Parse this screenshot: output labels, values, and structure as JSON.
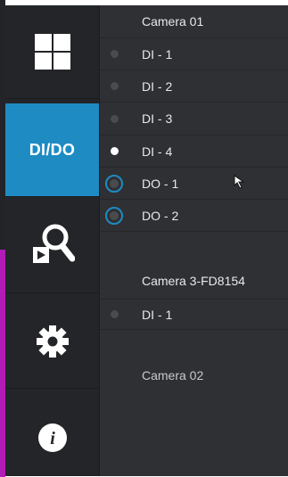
{
  "sidebar": {
    "items": [
      {
        "name": "layout",
        "icon": "grid-layout-icon"
      },
      {
        "name": "dido",
        "label": "DI/DO",
        "active": true
      },
      {
        "name": "search",
        "icon": "search-playback-icon"
      },
      {
        "name": "settings",
        "icon": "gear-icon"
      },
      {
        "name": "info",
        "icon": "info-icon"
      }
    ]
  },
  "panel": {
    "camera1": {
      "title": "Camera 01",
      "inputs": [
        {
          "label": "DI - 1",
          "state": "off"
        },
        {
          "label": "DI - 2",
          "state": "off"
        },
        {
          "label": "DI - 3",
          "state": "off"
        },
        {
          "label": "DI - 4",
          "state": "on"
        }
      ],
      "outputs": [
        {
          "label": "DO - 1"
        },
        {
          "label": "DO - 2"
        }
      ]
    },
    "camera2": {
      "title": "Camera 3-FD8154",
      "inputs": [
        {
          "label": "DI - 1",
          "state": "off"
        }
      ]
    },
    "camera3": {
      "title": "Camera 02"
    }
  },
  "colors": {
    "accent": "#1e8bc3",
    "sidebar_bg": "#232528",
    "panel_bg": "#2f3034",
    "magenta_strip": "#b11bb6"
  }
}
